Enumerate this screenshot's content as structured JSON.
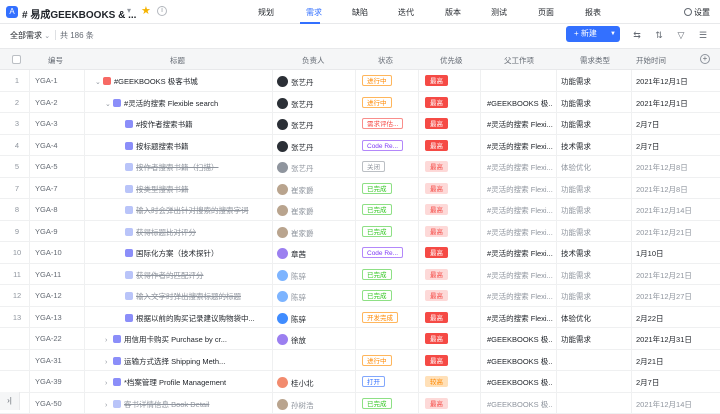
{
  "header": {
    "project_title": "# 易成GEEKBOOKS & ...",
    "nav": [
      {
        "label": "规划",
        "active": false
      },
      {
        "label": "需求",
        "active": true
      },
      {
        "label": "缺陷",
        "active": false
      },
      {
        "label": "迭代",
        "active": false
      },
      {
        "label": "版本",
        "active": false
      },
      {
        "label": "测试",
        "active": false
      },
      {
        "label": "页面",
        "active": false
      },
      {
        "label": "报表",
        "active": false
      }
    ],
    "settings_label": "设置"
  },
  "toolbar": {
    "filter_label": "全部需求",
    "count_label": "共 186 条",
    "new_button_label": "+ 新建"
  },
  "table": {
    "columns": [
      "编号",
      "标题",
      "负责人",
      "状态",
      "优先级",
      "父工作项",
      "需求类型",
      "开始时间"
    ],
    "rows": [
      {
        "idx": "1",
        "code": "YGA-1",
        "title": "#GEEKBOOKS 极客书城",
        "owner": "张艺丹",
        "status": "进行中",
        "status_style": "orange",
        "priority": "最高",
        "prio_style": "red",
        "parent": "",
        "type": "功能需求",
        "date": "2021年12月1日",
        "done": false,
        "level": 0,
        "expand": "down",
        "icon_color": "#f76964",
        "avatar_color": "#2b2f36"
      },
      {
        "idx": "2",
        "code": "YGA-2",
        "title": "#灵活的搜索 Flexible search",
        "owner": "张艺丹",
        "status": "进行中",
        "status_style": "orange",
        "priority": "最高",
        "prio_style": "red",
        "parent": "#GEEKBOOKS 极...",
        "type": "功能需求",
        "date": "2021年12月1日",
        "done": false,
        "level": 1,
        "expand": "down",
        "icon_color": "#8b8ef9",
        "avatar_color": "#2b2f36"
      },
      {
        "idx": "3",
        "code": "YGA-3",
        "title": "#按作者搜索书籍",
        "owner": "张艺丹",
        "status": "需求评估...",
        "status_style": "red",
        "priority": "最高",
        "prio_style": "red",
        "parent": "#灵活的搜索 Flexi...",
        "type": "功能需求",
        "date": "2月7日",
        "done": false,
        "level": 2,
        "expand": "",
        "icon_color": "#8b8ef9",
        "avatar_color": "#2b2f36"
      },
      {
        "idx": "4",
        "code": "YGA-4",
        "title": "按标题搜索书籍",
        "owner": "张艺丹",
        "status": "Code Re...",
        "status_style": "purple",
        "priority": "最高",
        "prio_style": "red",
        "parent": "#灵活的搜索 Flexi...",
        "type": "技术需求",
        "date": "2月7日",
        "done": false,
        "level": 2,
        "expand": "",
        "icon_color": "#8b8ef9",
        "avatar_color": "#2b2f36"
      },
      {
        "idx": "5",
        "code": "YGA-5",
        "title": "按作者搜索书籍（扫描）",
        "owner": "张艺丹",
        "status": "关闭",
        "status_style": "grey",
        "priority": "最高",
        "prio_style": "pink",
        "parent": "#灵活的搜索 Flexi...",
        "type": "体验优化",
        "date": "2021年12月8日",
        "done": true,
        "level": 2,
        "expand": "",
        "icon_color": "#b9c4f9",
        "avatar_color": "#8f959e"
      },
      {
        "idx": "7",
        "code": "YGA-7",
        "title": "按类型搜索书籍",
        "owner": "崔家爵",
        "status": "已完成",
        "status_style": "green",
        "priority": "最高",
        "prio_style": "pink",
        "parent": "#灵活的搜索 Flexi...",
        "type": "功能需求",
        "date": "2021年12月8日",
        "done": true,
        "level": 2,
        "expand": "",
        "icon_color": "#b9c4f9",
        "avatar_color": "#b9a48e"
      },
      {
        "idx": "8",
        "code": "YGA-8",
        "title": "输入时会弹出针对搜索的搜索字词",
        "owner": "崔家爵",
        "status": "已完成",
        "status_style": "green",
        "priority": "最高",
        "prio_style": "pink",
        "parent": "#灵活的搜索 Flexi...",
        "type": "功能需求",
        "date": "2021年12月14日",
        "done": true,
        "level": 2,
        "expand": "",
        "icon_color": "#b9c4f9",
        "avatar_color": "#b9a48e"
      },
      {
        "idx": "9",
        "code": "YGA-9",
        "title": "获得标题比对评分",
        "owner": "崔家爵",
        "status": "已完成",
        "status_style": "green",
        "priority": "最高",
        "prio_style": "pink",
        "parent": "#灵活的搜索 Flexi...",
        "type": "功能需求",
        "date": "2021年12月21日",
        "done": true,
        "level": 2,
        "expand": "",
        "icon_color": "#b9c4f9",
        "avatar_color": "#b9a48e"
      },
      {
        "idx": "10",
        "code": "YGA-10",
        "title": "国际化方案（技术探针）",
        "owner": "章茜",
        "status": "Code Re...",
        "status_style": "purple",
        "priority": "最高",
        "prio_style": "red",
        "parent": "#灵活的搜索 Flexi...",
        "type": "技术需求",
        "date": "1月10日",
        "done": false,
        "level": 2,
        "expand": "",
        "icon_color": "#8b8ef9",
        "avatar_color": "#9b7ff0"
      },
      {
        "idx": "11",
        "code": "YGA-11",
        "title": "获得作者的匹配评分",
        "owner": "陈骍",
        "status": "已完成",
        "status_style": "green",
        "priority": "最高",
        "prio_style": "pink",
        "parent": "#灵活的搜索 Flexi...",
        "type": "功能需求",
        "date": "2021年12月21日",
        "done": true,
        "level": 2,
        "expand": "",
        "icon_color": "#b9c4f9",
        "avatar_color": "#7db4ff"
      },
      {
        "idx": "12",
        "code": "YGA-12",
        "title": "输入文字时弹出搜索标题的标题",
        "owner": "陈骍",
        "status": "已完成",
        "status_style": "green",
        "priority": "最高",
        "prio_style": "pink",
        "parent": "#灵活的搜索 Flexi...",
        "type": "功能需求",
        "date": "2021年12月27日",
        "done": true,
        "level": 2,
        "expand": "",
        "icon_color": "#b9c4f9",
        "avatar_color": "#7db4ff"
      },
      {
        "idx": "13",
        "code": "YGA-13",
        "title": "根据以前的购买记录建议购物袋中...",
        "owner": "陈骍",
        "status": "开发完成",
        "status_style": "orange",
        "priority": "最高",
        "prio_style": "red",
        "parent": "#灵活的搜索 Flexi...",
        "type": "体验优化",
        "date": "2月22日",
        "done": false,
        "level": 2,
        "expand": "",
        "icon_color": "#8b8ef9",
        "avatar_color": "#3f8cff"
      },
      {
        "idx": "",
        "code": "YGA-22",
        "title": "用信用卡购买 Purchase by cr...",
        "owner": "徐放",
        "status": "",
        "status_style": "",
        "priority": "最高",
        "prio_style": "red",
        "parent": "#GEEKBOOKS 极...",
        "type": "功能需求",
        "date": "2021年12月31日",
        "done": false,
        "level": 1,
        "expand": "right",
        "icon_color": "#8b8ef9",
        "avatar_color": "#9b7ff0"
      },
      {
        "idx": "",
        "code": "YGA-31",
        "title": "运输方式选择 Shipping Meth...",
        "owner": "",
        "status": "进行中",
        "status_style": "orange",
        "priority": "最高",
        "prio_style": "red",
        "parent": "#GEEKBOOKS 极...",
        "type": "",
        "date": "2月21日",
        "done": false,
        "level": 1,
        "expand": "right",
        "icon_color": "#8b8ef9",
        "avatar_color": ""
      },
      {
        "idx": "",
        "code": "YGA-39",
        "title": "*档案管理 Profile Management",
        "owner": "桂小北",
        "status": "打开",
        "status_style": "blue",
        "priority": "较高",
        "prio_style": "orange",
        "parent": "#GEEKBOOKS 极...",
        "type": "",
        "date": "2月7日",
        "done": false,
        "level": 1,
        "expand": "right",
        "icon_color": "#8b8ef9",
        "avatar_color": "#f28b6e"
      },
      {
        "idx": "",
        "code": "YGA-50",
        "title": "客书详情信息 Book Detail",
        "owner": "孙树浩",
        "status": "已完成",
        "status_style": "green",
        "priority": "最高",
        "prio_style": "pink",
        "parent": "#GEEKBOOKS 极...",
        "type": "",
        "date": "2021年12月14日",
        "done": true,
        "level": 1,
        "expand": "right",
        "icon_color": "#b9c4f9",
        "avatar_color": "#b9a48e"
      }
    ]
  },
  "footer": {
    "collapse_label": "›|"
  }
}
